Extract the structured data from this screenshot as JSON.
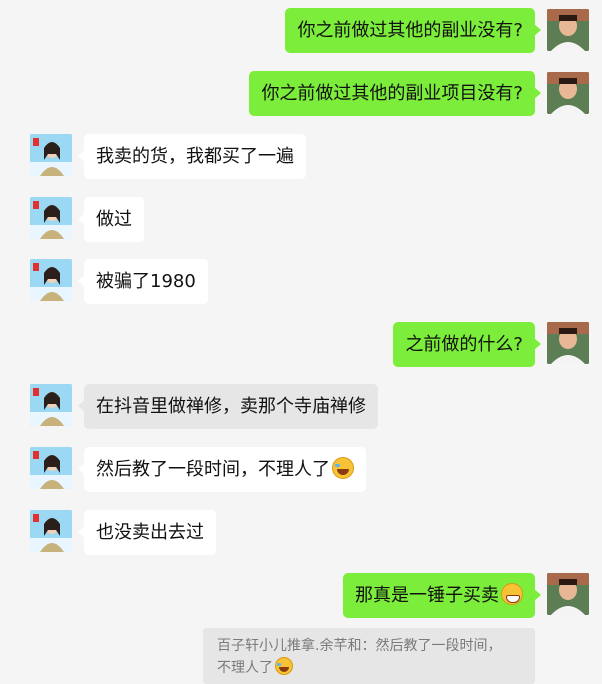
{
  "messages": [
    {
      "sender": "me",
      "text": "你之前做过其他的副业没有?"
    },
    {
      "sender": "me",
      "text": "你之前做过其他的副业项目没有?"
    },
    {
      "sender": "other",
      "text": "我卖的货，我都买了一遍"
    },
    {
      "sender": "other",
      "text": "做过"
    },
    {
      "sender": "other",
      "text": "被骗了1980"
    },
    {
      "sender": "me",
      "text": "之前做的什么?"
    },
    {
      "sender": "other",
      "text": "在抖音里做禅修，卖那个寺庙禅修"
    },
    {
      "sender": "other",
      "text": "然后教了一段时间，不理人了",
      "emoji": "laughing-tears-emoji"
    },
    {
      "sender": "other",
      "text": "也没卖出去过"
    },
    {
      "sender": "me",
      "text": "那真是一锤子买卖",
      "emoji": "grinning-emoji"
    }
  ],
  "quote": {
    "line1": "百子轩小儿推拿.余芊和：然后教了一段时间，",
    "line2": "不理人了",
    "emoji": "laughing-tears-emoji"
  },
  "colors": {
    "background": "#f5f5f5",
    "my_bubble": "#7bed3a",
    "other_bubble": "#ffffff",
    "highlighted_bubble": "#e6e6e6",
    "quote_text": "#7a7a7a"
  }
}
